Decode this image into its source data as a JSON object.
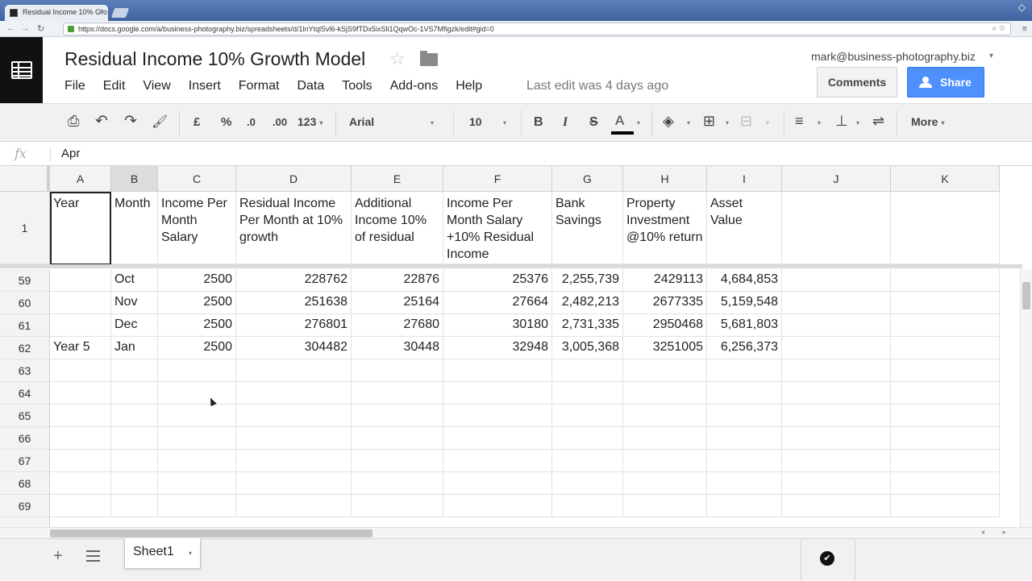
{
  "browser": {
    "tab_title": "Residual Income 10% Gro...",
    "tab_close": "×",
    "url": "https://docs.google.com/a/business-photography.biz/spreadsheets/d/1lnYtqlSvl6-kSjS9fTDx5ixSli1QqwOc-1VS7Mfigzk/edit#gid=0",
    "url_icons": "⌕ ☆",
    "menu_icon": "≡",
    "back": "←",
    "forward": "→",
    "reload": "↻",
    "window_ctrl": "◇"
  },
  "header": {
    "title": "Residual Income 10% Growth Model",
    "star": "☆",
    "menu": [
      "File",
      "Edit",
      "View",
      "Insert",
      "Format",
      "Data",
      "Tools",
      "Add-ons",
      "Help"
    ],
    "last_edit": "Last edit was 4 days ago",
    "user_email": "mark@business-photography.biz",
    "user_caret": "▾",
    "comments_label": "Comments",
    "share_label": "Share"
  },
  "toolbar": {
    "print": "⎙",
    "undo": "↶",
    "redo": "↷",
    "paint_format": "🖌",
    "currency": "£",
    "percent": "%",
    "dec_decrease": ".0",
    "dec_increase": ".00",
    "number_format": "123",
    "font": "Arial",
    "font_size": "10",
    "bold": "B",
    "italic": "I",
    "strike": "S",
    "text_color": "A",
    "fill_color": "◈",
    "borders": "⊞",
    "merge": "⊟",
    "align": "≡",
    "valign": "⊥",
    "wrap": "⇌",
    "more": "More",
    "caret": "▾",
    "accent": "#4d90fe"
  },
  "formula_bar": {
    "fx": "fx",
    "value": "Apr"
  },
  "columns": [
    "A",
    "B",
    "C",
    "D",
    "E",
    "F",
    "G",
    "H",
    "I",
    "J",
    "K"
  ],
  "header_row": {
    "number": "1",
    "cells": [
      "Year",
      "Month",
      "Income Per Month Salary",
      "Residual Income Per Month at 10% growth",
      "Additional Income 10% of residual",
      "Income Per Month Salary +10% Residual Income",
      "Bank Savings",
      "Property Investment @10% return",
      "Asset Value",
      "",
      ""
    ]
  },
  "rows": [
    {
      "number": "59",
      "cells": [
        "",
        "Oct",
        "2500",
        "228762",
        "22876",
        "25376",
        "2,255,739",
        "2429113",
        "4,684,853",
        "",
        ""
      ]
    },
    {
      "number": "60",
      "cells": [
        "",
        "Nov",
        "2500",
        "251638",
        "25164",
        "27664",
        "2,482,213",
        "2677335",
        "5,159,548",
        "",
        ""
      ]
    },
    {
      "number": "61",
      "cells": [
        "",
        "Dec",
        "2500",
        "276801",
        "27680",
        "30180",
        "2,731,335",
        "2950468",
        "5,681,803",
        "",
        ""
      ]
    },
    {
      "number": "62",
      "cells": [
        "Year 5",
        "Jan",
        "2500",
        "304482",
        "30448",
        "32948",
        "3,005,368",
        "3251005",
        "6,256,373",
        "",
        ""
      ]
    },
    {
      "number": "63",
      "cells": [
        "",
        "",
        "",
        "",
        "",
        "",
        "",
        "",
        "",
        "",
        ""
      ]
    },
    {
      "number": "64",
      "cells": [
        "",
        "",
        "",
        "",
        "",
        "",
        "",
        "",
        "",
        "",
        ""
      ]
    },
    {
      "number": "65",
      "cells": [
        "",
        "",
        "",
        "",
        "",
        "",
        "",
        "",
        "",
        "",
        ""
      ]
    },
    {
      "number": "66",
      "cells": [
        "",
        "",
        "",
        "",
        "",
        "",
        "",
        "",
        "",
        "",
        ""
      ]
    },
    {
      "number": "67",
      "cells": [
        "",
        "",
        "",
        "",
        "",
        "",
        "",
        "",
        "",
        "",
        ""
      ]
    },
    {
      "number": "68",
      "cells": [
        "",
        "",
        "",
        "",
        "",
        "",
        "",
        "",
        "",
        "",
        ""
      ]
    },
    {
      "number": "69",
      "cells": [
        "",
        "",
        "",
        "",
        "",
        "",
        "",
        "",
        "",
        "",
        ""
      ]
    }
  ],
  "sheets": {
    "add": "+",
    "active_sheet": "Sheet1",
    "caret": "▾",
    "saved_icon": "✔",
    "h_arrows": "◂ ▸"
  }
}
